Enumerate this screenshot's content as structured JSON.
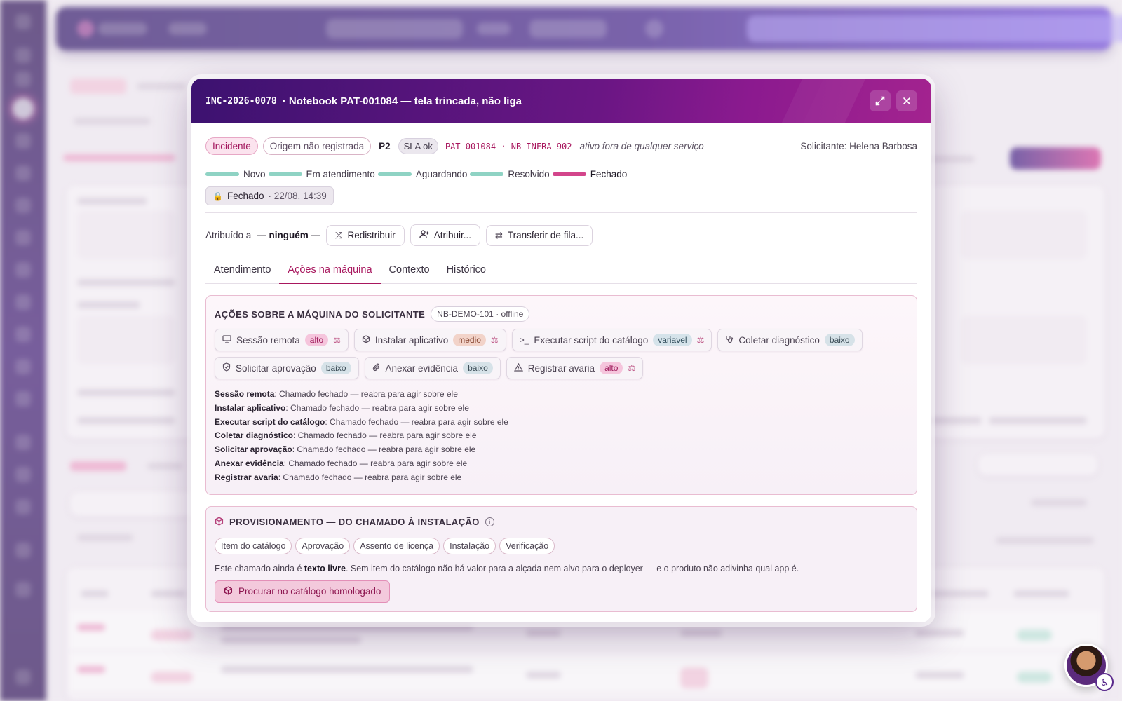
{
  "ticket": {
    "code": "INC-2026-0078",
    "title": "· Notebook PAT-001084 — tela trincada, não liga"
  },
  "header": {
    "expand_icon": "expand-icon",
    "close_icon": "close-icon"
  },
  "meta": {
    "type_chip": "Incidente",
    "origin_chip": "Origem não registrada",
    "priority": "P2",
    "sla_chip": "SLA ok",
    "asset_codes": "PAT-001084 · NB-INFRA-902",
    "asset_note": "ativo fora de qualquer serviço",
    "requester": "Solicitante: Helena Barbosa"
  },
  "status": {
    "steps": [
      "Novo",
      "Em atendimento",
      "Aguardando",
      "Resolvido",
      "Fechado"
    ],
    "current": "Fechado",
    "closed_label": "Fechado",
    "closed_when": "· 22/08, 14:39"
  },
  "assignment": {
    "prefix": "Atribuído a",
    "assignee": "— ninguém —",
    "redistribute": "Redistribuir",
    "assign": "Atribuir...",
    "transfer": "Transferir de fila..."
  },
  "tabs": [
    {
      "label": "Atendimento",
      "active": false
    },
    {
      "label": "Ações na máquina",
      "active": true
    },
    {
      "label": "Contexto",
      "active": false
    },
    {
      "label": "Histórico",
      "active": false
    }
  ],
  "machine_actions": {
    "title": "AÇÕES SOBRE A MÁQUINA DO SOLICITANTE",
    "device": "NB-DEMO-101 · offline",
    "actions": [
      {
        "label": "Sessão remota",
        "risk": "alto",
        "risk_class": "alto",
        "icon": "monitor-icon",
        "gated": true
      },
      {
        "label": "Instalar aplicativo",
        "risk": "medio",
        "risk_class": "medio",
        "icon": "package-icon",
        "gated": true
      },
      {
        "label": "Executar script do catálogo",
        "risk": "variavel",
        "risk_class": "variavel",
        "icon": "terminal-icon",
        "gated": true
      },
      {
        "label": "Coletar diagnóstico",
        "risk": "baixo",
        "risk_class": "baixo",
        "icon": "stethoscope-icon",
        "gated": false
      },
      {
        "label": "Solicitar aprovação",
        "risk": "baixo",
        "risk_class": "baixo",
        "icon": "shield-check-icon",
        "gated": false
      },
      {
        "label": "Anexar evidência",
        "risk": "baixo",
        "risk_class": "baixo",
        "icon": "paperclip-icon",
        "gated": false
      },
      {
        "label": "Registrar avaria",
        "risk": "alto",
        "risk_class": "alto",
        "icon": "warning-icon",
        "gated": true
      }
    ],
    "notes": [
      {
        "name": "Sessão remota",
        "text": ": Chamado fechado — reabra para agir sobre ele"
      },
      {
        "name": "Instalar aplicativo",
        "text": ": Chamado fechado — reabra para agir sobre ele"
      },
      {
        "name": "Executar script do catálogo",
        "text": ": Chamado fechado — reabra para agir sobre ele"
      },
      {
        "name": "Coletar diagnóstico",
        "text": ": Chamado fechado — reabra para agir sobre ele"
      },
      {
        "name": "Solicitar aprovação",
        "text": ": Chamado fechado — reabra para agir sobre ele"
      },
      {
        "name": "Anexar evidência",
        "text": ": Chamado fechado — reabra para agir sobre ele"
      },
      {
        "name": "Registrar avaria",
        "text": ": Chamado fechado — reabra para agir sobre ele"
      }
    ]
  },
  "provisioning": {
    "title": "PROVISIONAMENTO — DO CHAMADO À INSTALAÇÃO",
    "steps": [
      "Item do catálogo",
      "Aprovação",
      "Assento de licença",
      "Instalação",
      "Verificação"
    ],
    "text_before": "Este chamado ainda é ",
    "text_bold": "texto livre",
    "text_after": ". Sem item do catálogo não há valor para a alçada nem alvo para o deployer — e o produto não adivinha qual app é.",
    "button": "Procurar no catálogo homologado"
  },
  "colors": {
    "accent": "#a8175e",
    "header_start": "#3c1270",
    "header_end": "#a3238f",
    "status_done": "#8fd3c4",
    "status_current": "#d3458b"
  }
}
